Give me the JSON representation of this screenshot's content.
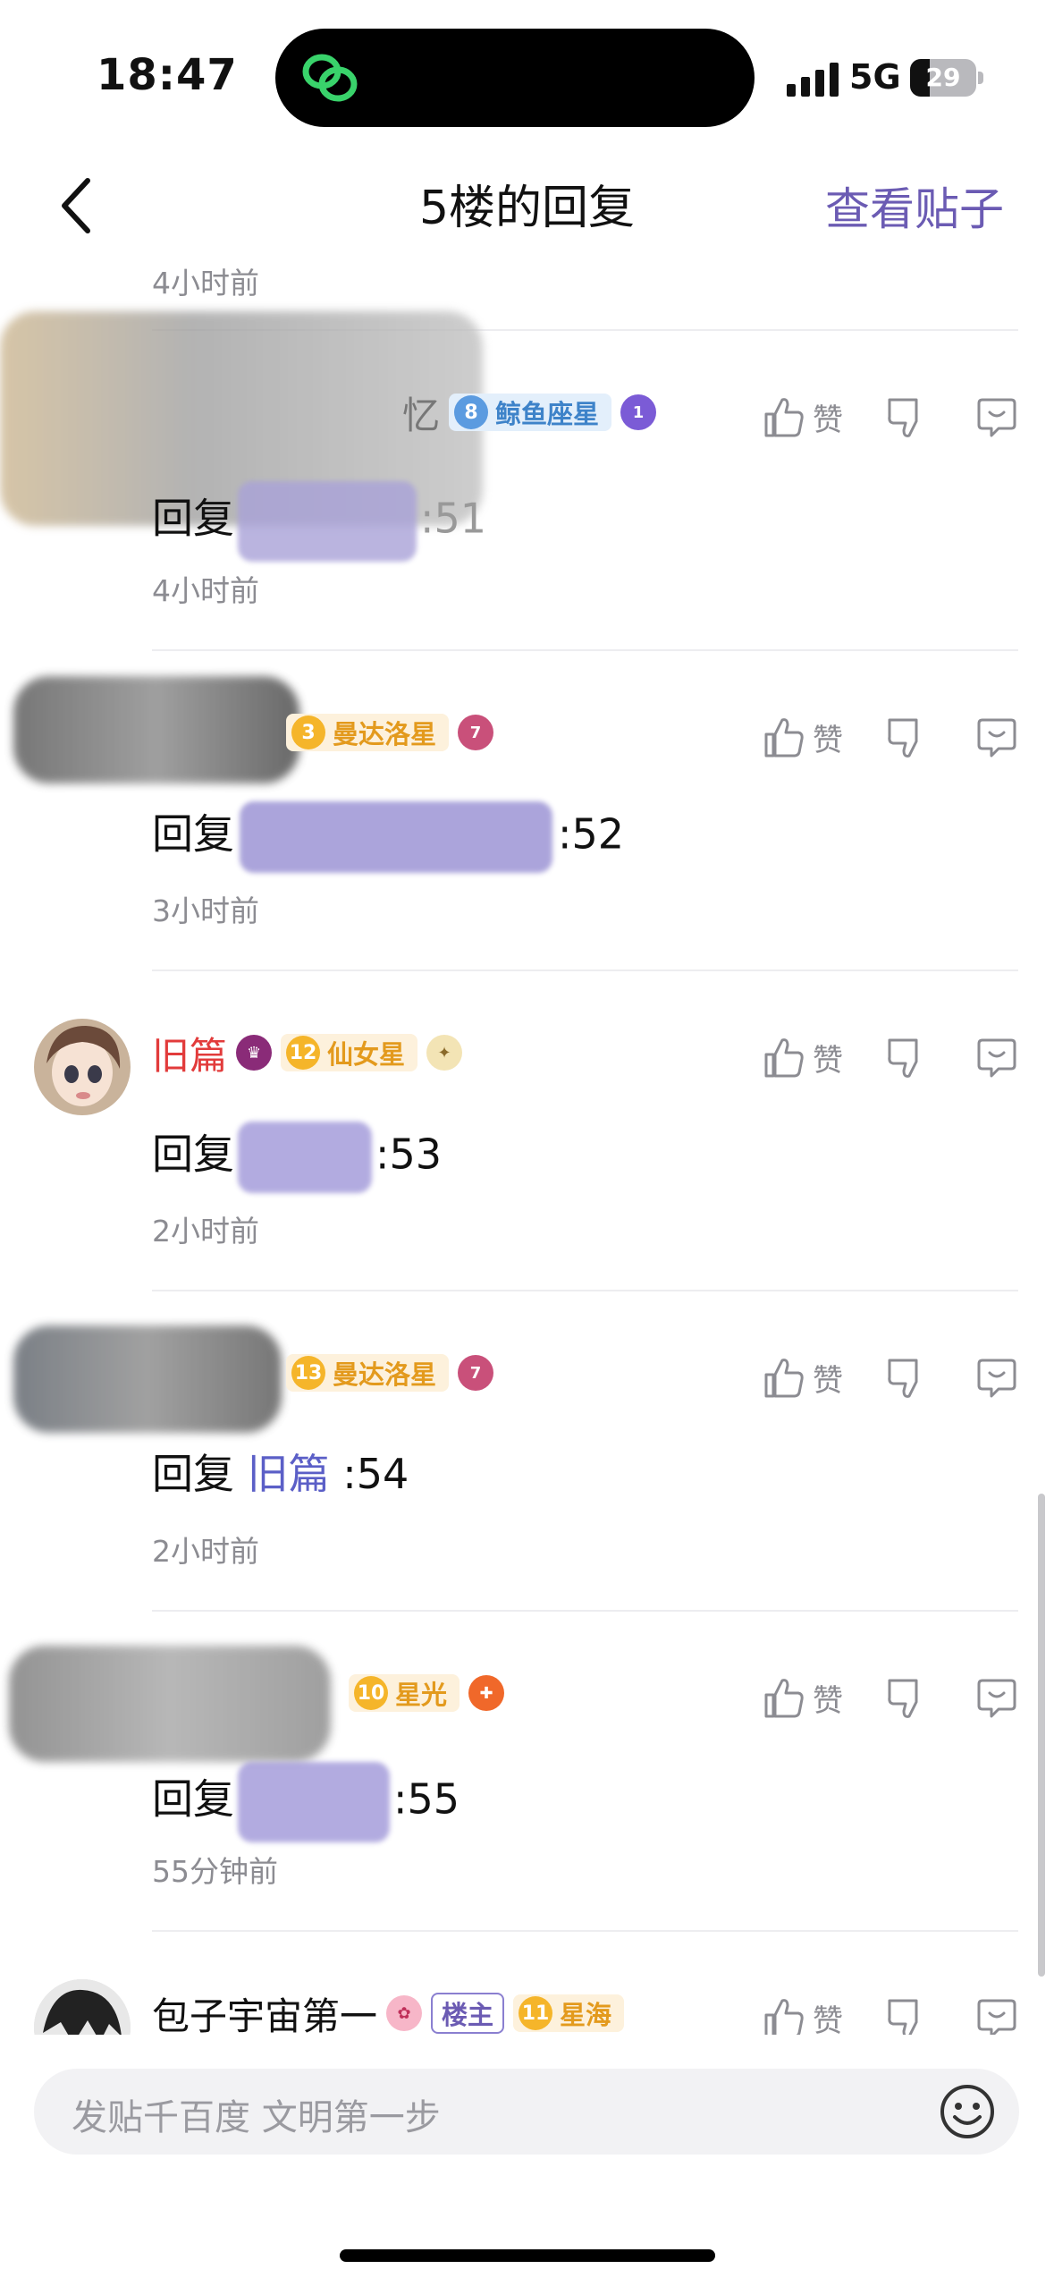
{
  "status_bar": {
    "time": "18:47",
    "network": "5G",
    "battery": "29",
    "island_icon": "link-app-icon"
  },
  "nav": {
    "back_icon": "chevron-left-icon",
    "title": "5楼的回复",
    "link": "查看贴子"
  },
  "top_timestamp": "4小时前",
  "replies": [
    {
      "name": "忆",
      "level": "8",
      "level_name": "鲸鱼座星",
      "medal": "1",
      "prefix": "回复",
      "suffix": ":51",
      "time": "4小时前",
      "like_label": "赞"
    },
    {
      "name": "",
      "level": "3",
      "level_name": "曼达洛星",
      "medal": "7",
      "prefix": "回复",
      "suffix": ":52",
      "time": "3小时前",
      "like_label": "赞"
    },
    {
      "name": "旧篇",
      "level": "12",
      "level_name": "仙女星",
      "medal": "",
      "prefix": "回复",
      "suffix": ":53",
      "time": "2小时前",
      "like_label": "赞"
    },
    {
      "name": "",
      "level": "13",
      "level_name": "曼达洛星",
      "medal": "7",
      "prefix": "回复",
      "mention": "旧篇",
      "suffix": ":54",
      "time": "2小时前",
      "like_label": "赞"
    },
    {
      "name": "",
      "level": "10",
      "level_name": "星光",
      "medal": "",
      "prefix": "回复",
      "suffix": ":55",
      "time": "55分钟前",
      "like_label": "赞"
    },
    {
      "name": "包子宇宙第一",
      "badge": "楼主",
      "level": "11",
      "level_name": "星海",
      "like_label": "赞"
    }
  ],
  "composer": {
    "placeholder": "发贴千百度 文明第一步",
    "emoji_icon": "smiley-icon"
  },
  "colors": {
    "accent": "#6b5bb3",
    "mention": "#5b5fc7",
    "red_name": "#e23b3b",
    "muted": "#8c8c92"
  }
}
